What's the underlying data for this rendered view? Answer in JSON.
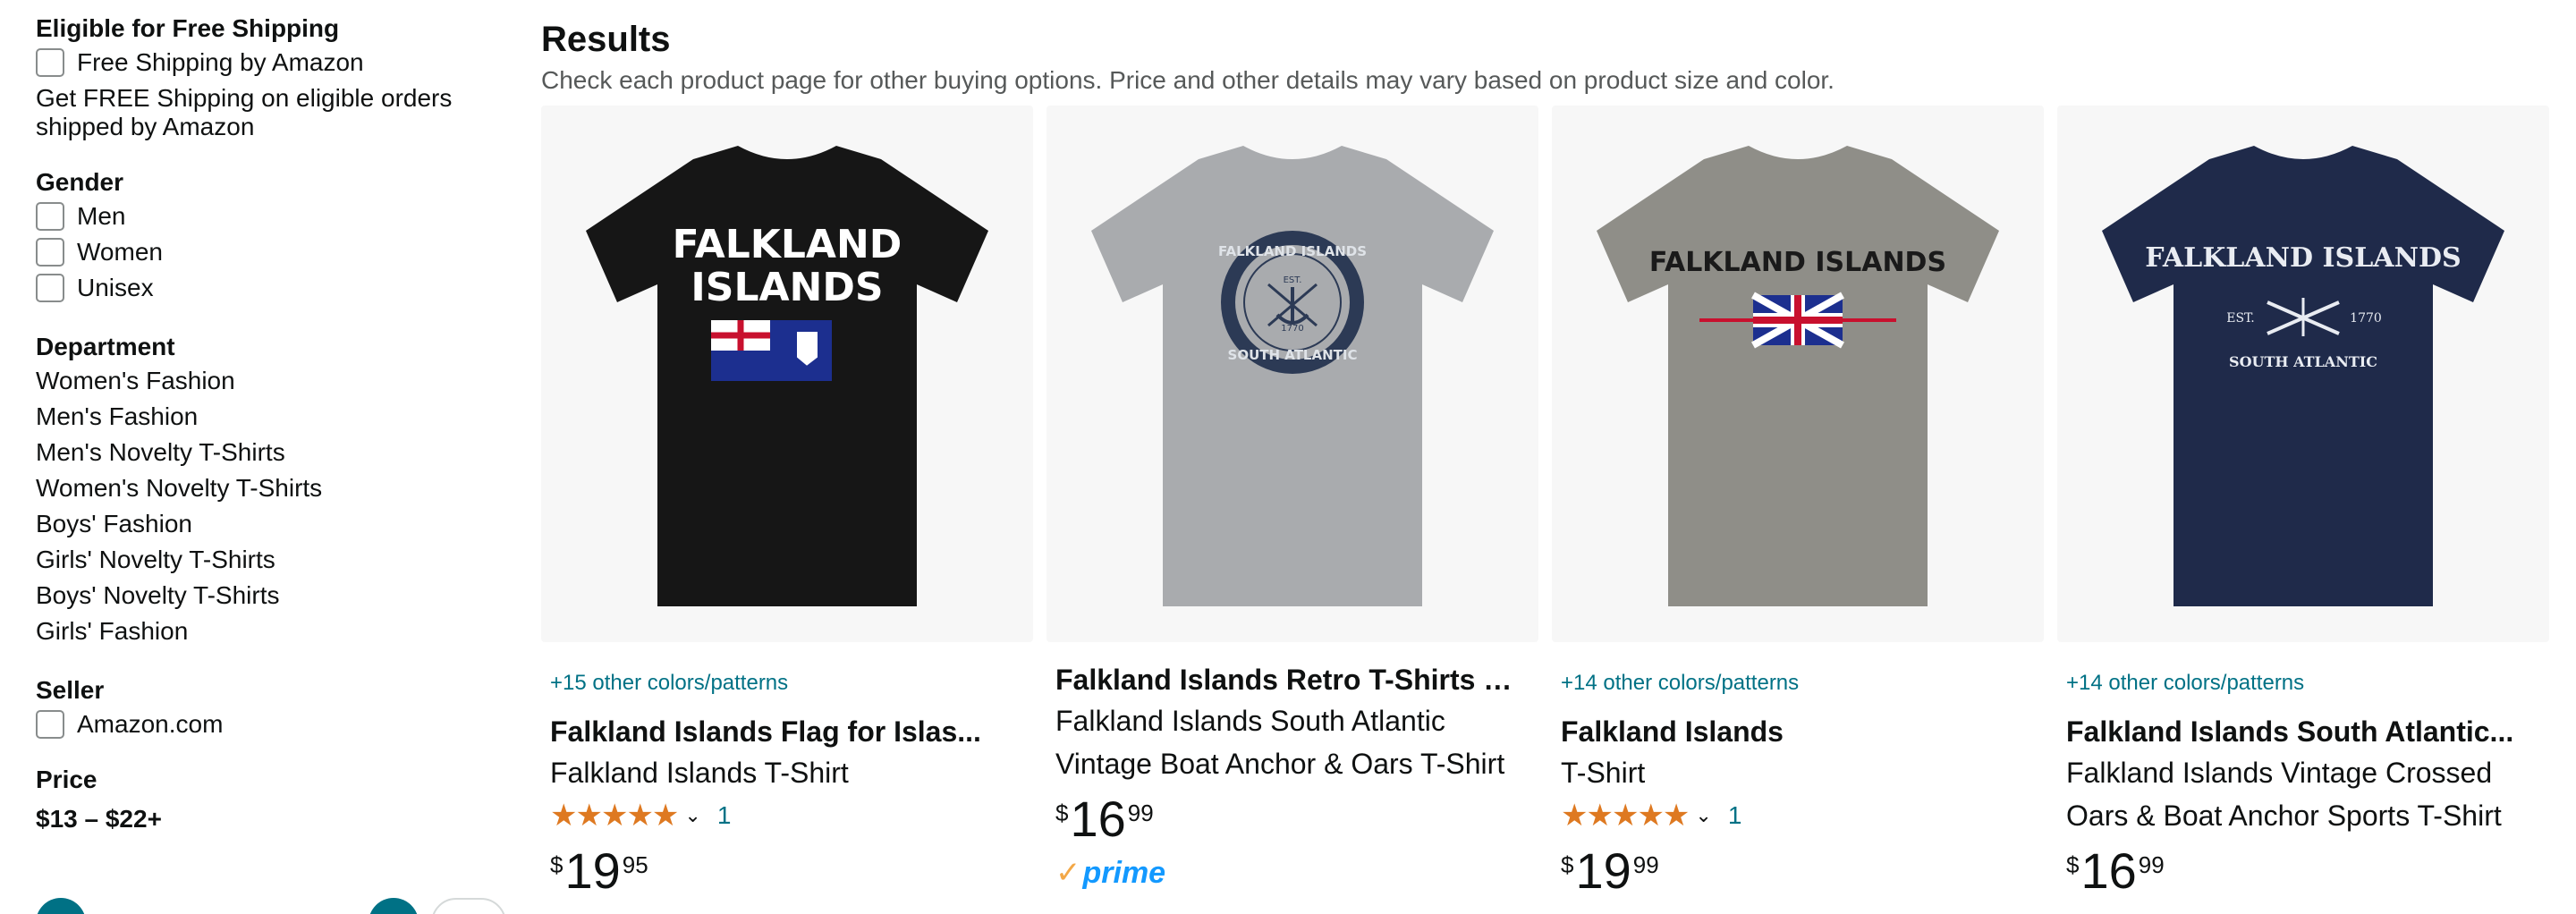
{
  "sidebar": {
    "free_shipping": {
      "heading": "Eligible for Free Shipping",
      "option": "Free Shipping by Amazon",
      "note": "Get FREE Shipping on eligible orders shipped by Amazon"
    },
    "gender": {
      "heading": "Gender",
      "options": [
        "Men",
        "Women",
        "Unisex"
      ]
    },
    "department": {
      "heading": "Department",
      "links": [
        "Women's Fashion",
        "Men's Fashion",
        "Men's Novelty T-Shirts",
        "Women's Novelty T-Shirts",
        "Boys' Fashion",
        "Girls' Novelty T-Shirts",
        "Boys' Novelty T-Shirts",
        "Girls' Fashion"
      ]
    },
    "seller": {
      "heading": "Seller",
      "option": "Amazon.com"
    },
    "price": {
      "heading": "Price",
      "range": "$13 – $22+"
    }
  },
  "results": {
    "title": "Results",
    "subtitle": "Check each product page for other buying options. Price and other details may vary based on product size and color."
  },
  "products": [
    {
      "colors": "+15 other colors/patterns",
      "title": "Falkland Islands Flag for Islas...",
      "subtitle": "Falkland Islands T-Shirt",
      "stars": "★★★★★",
      "rating_count": "1",
      "price_symbol": "$",
      "price_whole": "19",
      "price_fraction": "95",
      "shirt_color": "#161616",
      "print_text_1": "FALKLAND",
      "print_text_2": "ISLANDS"
    },
    {
      "title": "Falkland Islands Retro T-Shirts &...",
      "subtitle": "Falkland Islands South Atlantic Vintage Boat Anchor & Oars T-Shirt",
      "price_symbol": "$",
      "price_whole": "16",
      "price_fraction": "99",
      "prime": "prime",
      "shirt_color": "#a9abae",
      "print_text_1": "FALKLAND ISLANDS",
      "print_text_2": "SOUTH ATLANTIC",
      "print_text_3": "EST.",
      "print_text_4": "1770"
    },
    {
      "colors": "+14 other colors/patterns",
      "title": "Falkland Islands",
      "subtitle": "T-Shirt",
      "stars": "★★★★★",
      "rating_count": "1",
      "price_symbol": "$",
      "price_whole": "19",
      "price_fraction": "99",
      "shirt_color": "#8f8e88",
      "print_text_1": "FALKLAND ISLANDS"
    },
    {
      "colors": "+14 other colors/patterns",
      "title": "Falkland Islands South Atlantic...",
      "subtitle": "Falkland Islands Vintage Crossed Oars & Boat Anchor Sports T-Shirt",
      "price_symbol": "$",
      "price_whole": "16",
      "price_fraction": "99",
      "shirt_color": "#1f2a4a",
      "print_text_1": "FALKLAND ISLANDS",
      "print_text_2": "SOUTH ATLANTIC",
      "print_text_3": "EST.",
      "print_text_4": "1770"
    }
  ]
}
